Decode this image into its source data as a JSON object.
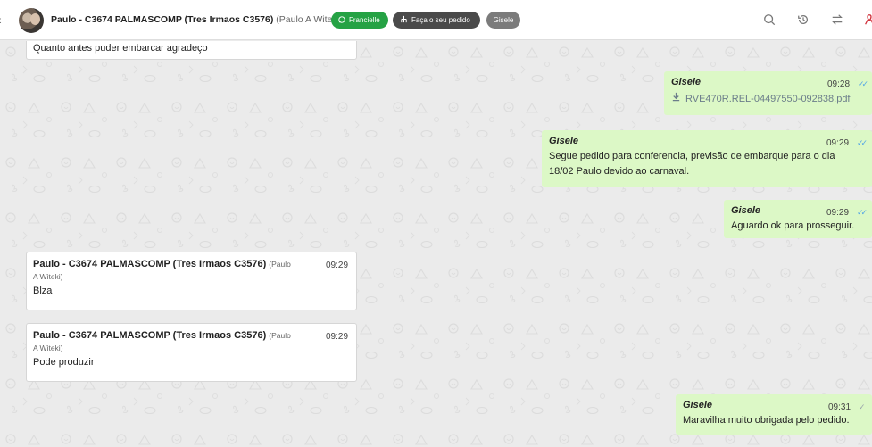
{
  "header": {
    "contact_name": "Paulo - C3674 PALMASCOMP (Tres Irmaos C3576)",
    "contact_sub": "(Paulo A Witeki)",
    "tags": [
      {
        "label": "Francielle",
        "icon": "whatsapp-icon",
        "color": "#25a244"
      },
      {
        "label": "Faça o seu pedido",
        "icon": "flow-icon",
        "color": "#4a4a4a"
      },
      {
        "label": "Gisele",
        "color": "#7b7b7b"
      }
    ],
    "icons": [
      "search-icon",
      "history-icon",
      "transfer-icon",
      "ribbon-icon"
    ]
  },
  "messages": {
    "m0": {
      "text": "Quanto antes puder embarcar agradeço"
    },
    "m1": {
      "sender": "Gisele",
      "time": "09:28",
      "file": "RVE470R.REL-04497550-092838.pdf"
    },
    "m2": {
      "sender": "Gisele",
      "time": "09:29",
      "line1": "Segue pedido para conferencia, previsão de embarque para o dia",
      "line2": "18/02 Paulo devido ao carnaval."
    },
    "m3": {
      "sender": "Gisele",
      "time": "09:29",
      "text": "Aguardo ok para prosseguir."
    },
    "m4": {
      "sender": "Paulo - C3674 PALMASCOMP (Tres Irmaos C3576)",
      "sender_sub_a": "(Paulo",
      "sender_sub_b": "A Witeki)",
      "time": "09:29",
      "text": "Blza"
    },
    "m5": {
      "sender": "Paulo - C3674 PALMASCOMP (Tres Irmaos C3576)",
      "sender_sub_a": "(Paulo",
      "sender_sub_b": "A Witeki)",
      "time": "09:29",
      "text": "Pode produzir"
    },
    "m6": {
      "sender": "Gisele",
      "time": "09:31",
      "text": "Maravilha muito obrigada pelo pedido."
    }
  },
  "colors": {
    "outgoing": "#dcf8c6",
    "incoming": "#ffffff",
    "read_ticks": "#53a6e6",
    "background": "#ebebeb"
  }
}
